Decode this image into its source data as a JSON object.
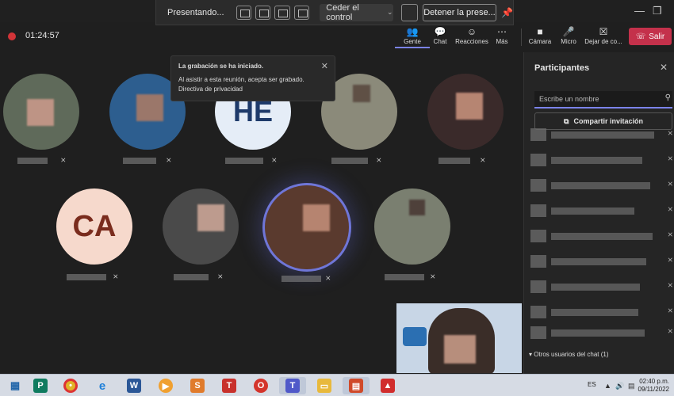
{
  "window": {
    "minimize": "—",
    "restore": "❐"
  },
  "sharing_toolbar": {
    "presenting": "Presentando...",
    "give_control": "Ceder el control",
    "stop_presenting": "Detener la prese..."
  },
  "meeting": {
    "timer": "01:24:57",
    "controls": {
      "people": "Gente",
      "chat": "Chat",
      "reactions": "Reacciones",
      "more": "Más",
      "camera": "Cámara",
      "mic": "Micro",
      "share": "Dejar de co...",
      "leave": "Salir"
    }
  },
  "toast": {
    "title": "La grabación se ha iniciado.",
    "body": "Al asistir a esta reunión, acepta ser grabado.",
    "link": "Directiva de privacidad"
  },
  "tiles": [
    {
      "kind": "photo"
    },
    {
      "kind": "photo"
    },
    {
      "kind": "initials",
      "text": "HE"
    },
    {
      "kind": "photo"
    },
    {
      "kind": "photo"
    },
    {
      "kind": "initials",
      "text": "CA"
    },
    {
      "kind": "photo"
    },
    {
      "kind": "photo",
      "active": true
    },
    {
      "kind": "photo"
    }
  ],
  "panel": {
    "title": "Participantes",
    "search_placeholder": "Escribe un nombre",
    "invite": "Compartir invitación",
    "others_section": "Otros usuarios del chat (1)"
  },
  "taskbar": {
    "lang": "ES",
    "time": "02:40 p.m.",
    "date": "09/11/2022",
    "apps": [
      "P",
      "chrome",
      "ie",
      "word",
      "media",
      "S",
      "T",
      "opera",
      "teams",
      "explorer",
      "slides",
      "pdf"
    ]
  },
  "colors": {
    "accent": "#7b83eb",
    "leave": "#c4314b",
    "record": "#d13438"
  }
}
